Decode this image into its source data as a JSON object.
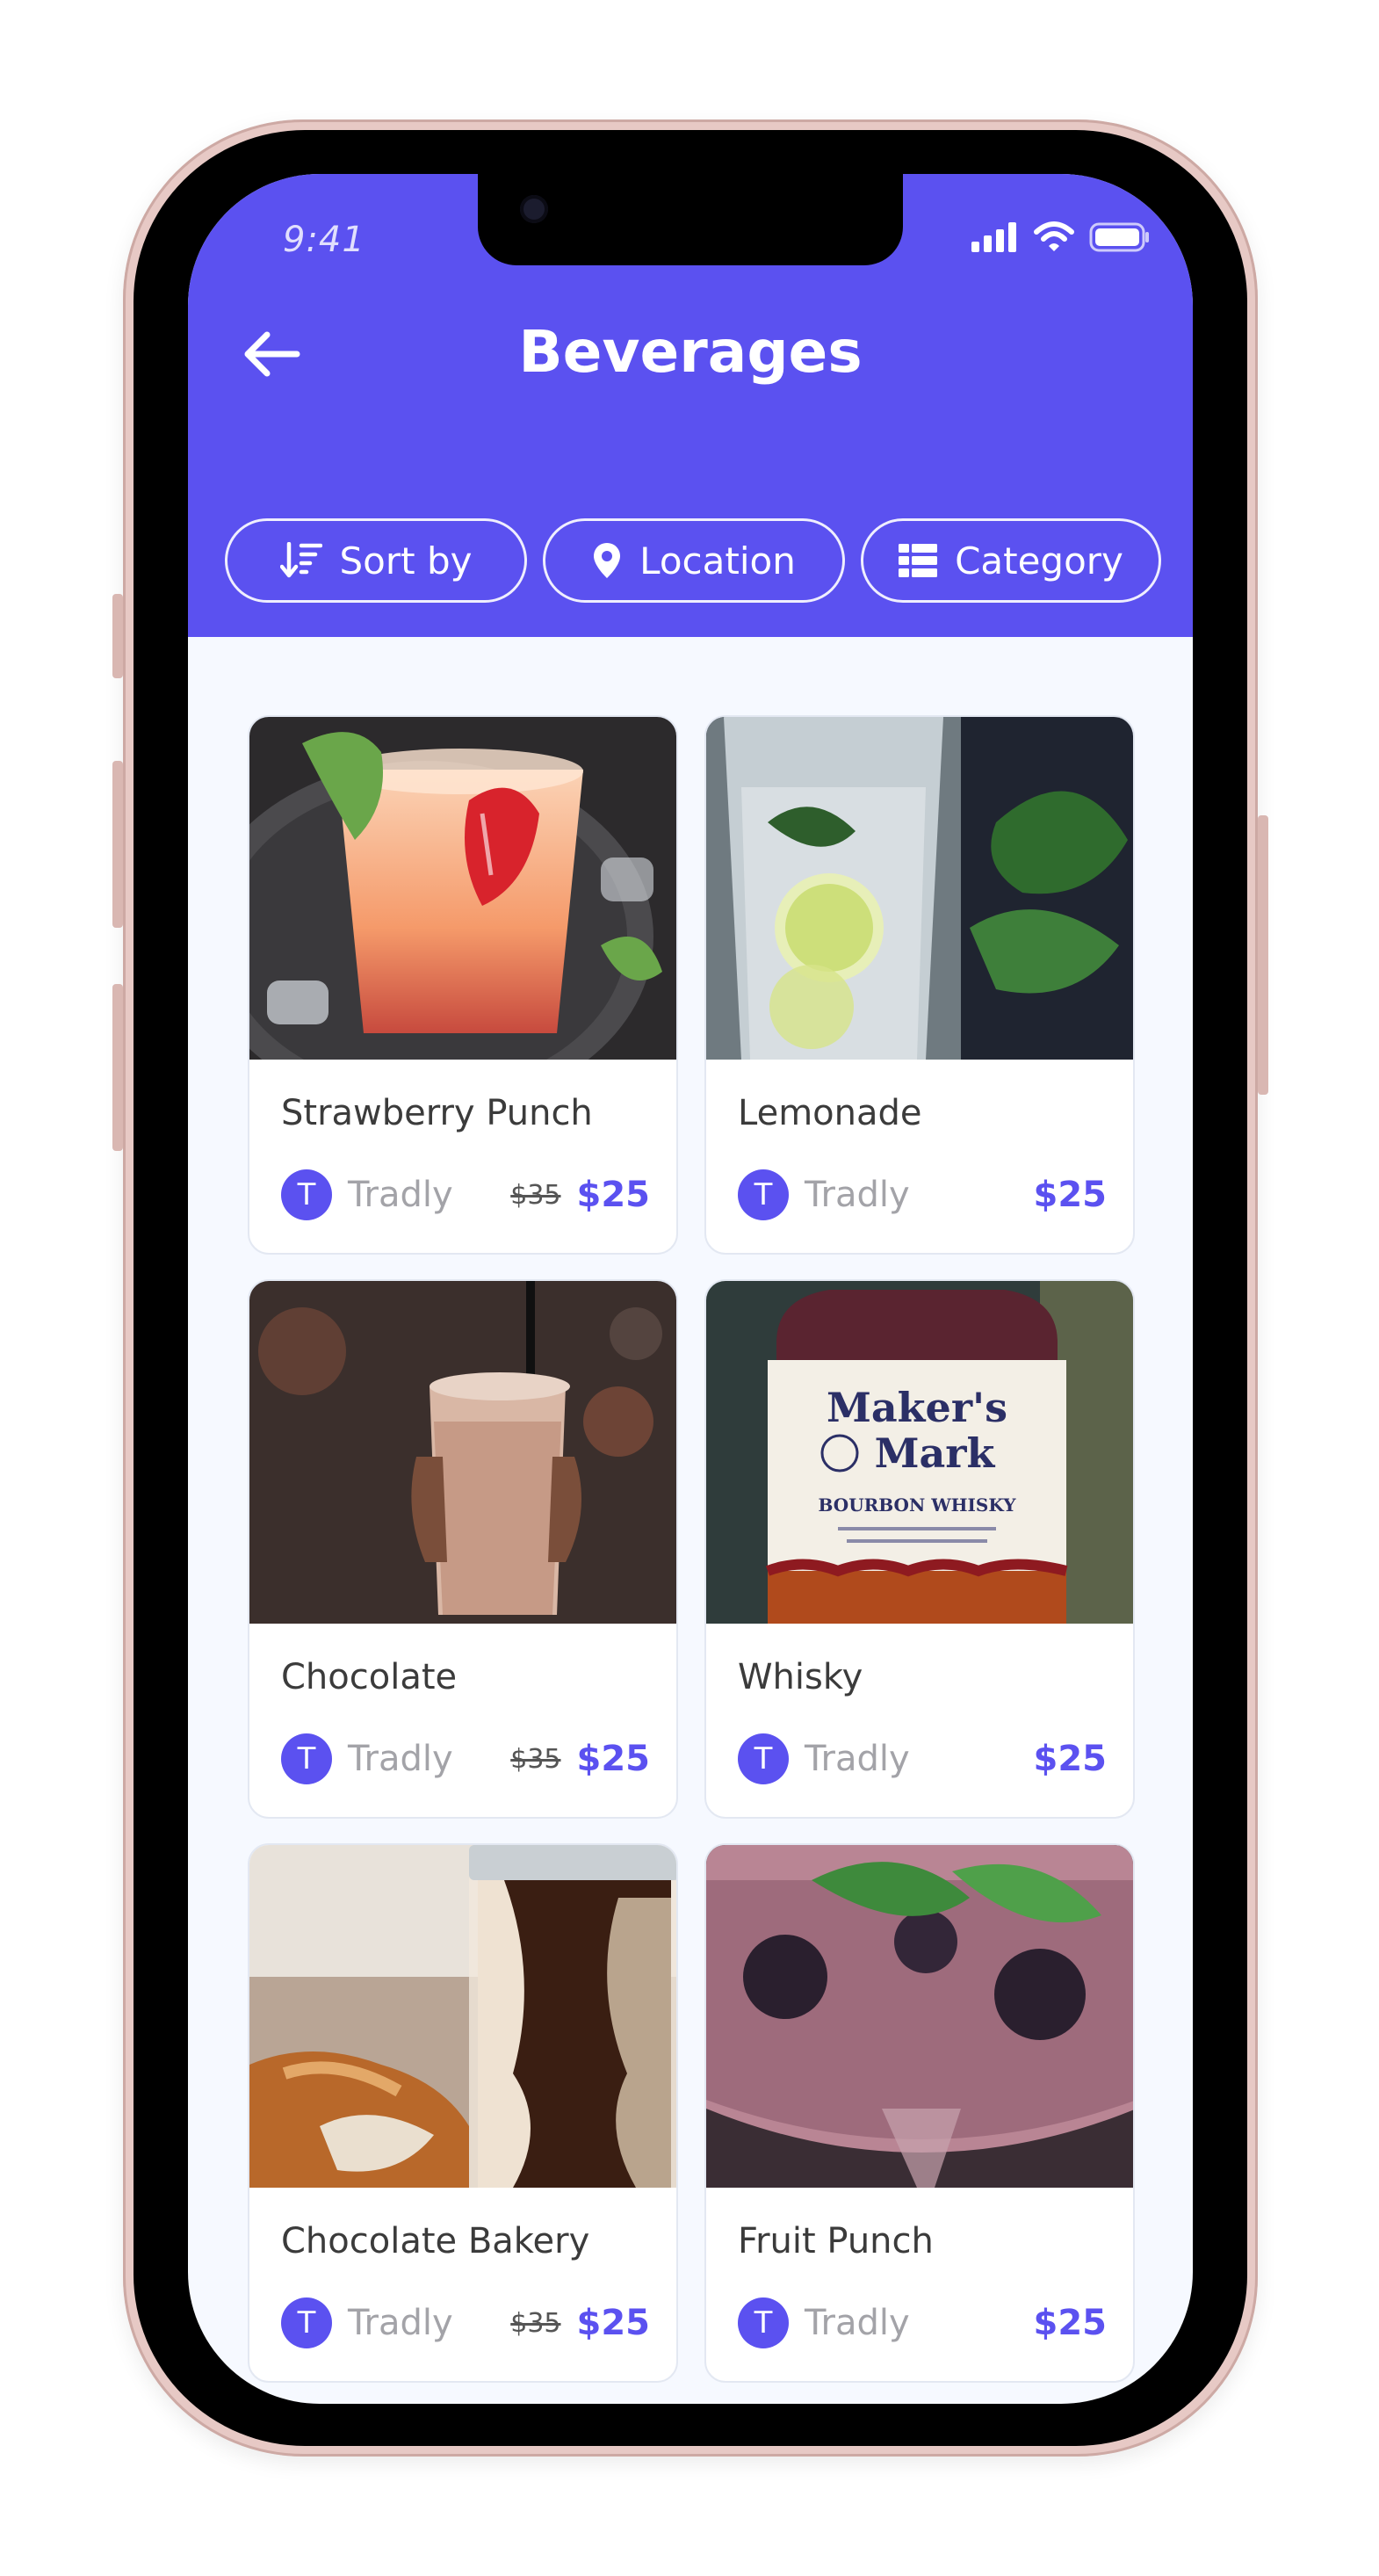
{
  "status_bar": {
    "time": "9:41"
  },
  "header": {
    "title": "Beverages",
    "background_color": "#5b51f0",
    "back_icon": "arrow-left-icon"
  },
  "filters": [
    {
      "label": "Sort by",
      "icon": "sort-icon"
    },
    {
      "label": "Location",
      "icon": "location-pin-icon"
    },
    {
      "label": "Category",
      "icon": "category-list-icon"
    }
  ],
  "products": [
    {
      "name": "Strawberry Punch",
      "store": "Tradly",
      "store_initial": "T",
      "old_price": "$35",
      "price": "$25"
    },
    {
      "name": "Lemonade",
      "store": "Tradly",
      "store_initial": "T",
      "old_price": "",
      "price": "$25"
    },
    {
      "name": "Chocolate",
      "store": "Tradly",
      "store_initial": "T",
      "old_price": "$35",
      "price": "$25"
    },
    {
      "name": "Whisky",
      "store": "Tradly",
      "store_initial": "T",
      "old_price": "",
      "price": "$25"
    },
    {
      "name": "Chocolate Bakery",
      "store": "Tradly",
      "store_initial": "T",
      "old_price": "$35",
      "price": "$25"
    },
    {
      "name": "Fruit Punch",
      "store": "Tradly",
      "store_initial": "T",
      "old_price": "",
      "price": "$25"
    }
  ],
  "bottle_label": {
    "brand_line1": "Maker's",
    "brand_line2": "Mark",
    "subtitle": "BOURBON WHISKY"
  },
  "colors": {
    "accent": "#5b51f0",
    "screen_background": "#f6f9ff",
    "store_text": "#a3a3a8"
  }
}
